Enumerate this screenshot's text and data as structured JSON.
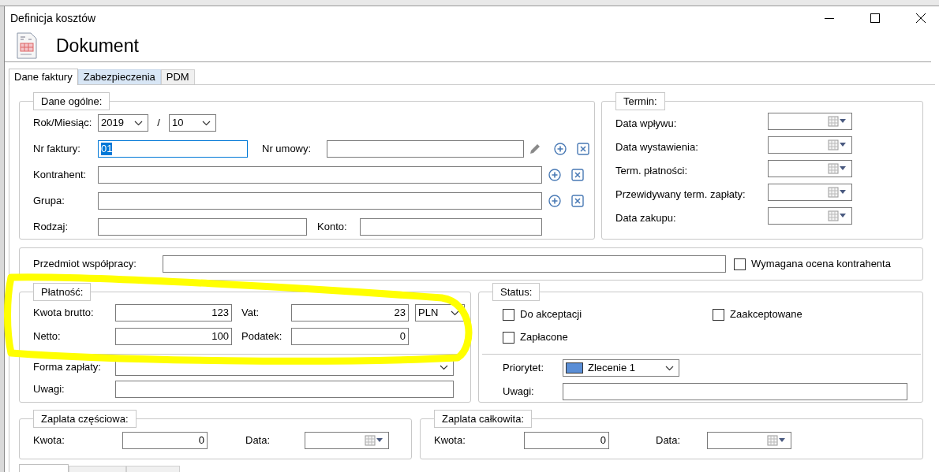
{
  "window": {
    "title": "Definicja kosztów"
  },
  "header": {
    "title": "Dokument"
  },
  "tabs": [
    {
      "label": "Dane faktury",
      "selected": true,
      "hovered": false
    },
    {
      "label": "Zabezpieczenia",
      "selected": false,
      "hovered": true
    },
    {
      "label": "PDM",
      "selected": false,
      "hovered": false
    }
  ],
  "general": {
    "legend": "Dane ogólne:",
    "period": {
      "label": "Rok/Miesiąc:",
      "year": "2019",
      "separator": "/",
      "month": "10"
    },
    "invoice_no": {
      "label": "Nr faktury:",
      "value": "01",
      "focused": true
    },
    "contract_no": {
      "label": "Nr umowy:"
    },
    "contractor": {
      "label": "Kontrahent:"
    },
    "group": {
      "label": "Grupa:"
    },
    "kind": {
      "label": "Rodzaj:"
    },
    "account": {
      "label": "Konto:"
    }
  },
  "terms": {
    "legend": "Termin:",
    "fields": [
      {
        "label": "Data wpływu:"
      },
      {
        "label": "Data wystawienia:"
      },
      {
        "label": "Term. płatności:"
      },
      {
        "label": "Przewidywany term. zapłaty:"
      },
      {
        "label": "Data zakupu:"
      }
    ]
  },
  "subject": {
    "label": "Przedmiot współpracy:",
    "checkbox": {
      "label": "Wymagana ocena kontrahenta",
      "checked": false
    }
  },
  "payment": {
    "legend": "Płatność:",
    "highlighted": true,
    "gross": {
      "label": "Kwota brutto:",
      "value": "123"
    },
    "vat": {
      "label": "Vat:",
      "value": "23"
    },
    "currency": "PLN",
    "net": {
      "label": "Netto:",
      "value": "100"
    },
    "tax": {
      "label": "Podatek:",
      "value": "0"
    },
    "method": {
      "label": "Forma zapłaty:"
    },
    "notes": {
      "label": "Uwagi:"
    }
  },
  "status": {
    "legend": "Status:",
    "checkboxes": [
      {
        "label": "Do akceptacji",
        "checked": false
      },
      {
        "label": "Zaakceptowane",
        "checked": false
      },
      {
        "label": "Zapłacone",
        "checked": false
      }
    ],
    "priority": {
      "label": "Priorytet:",
      "value": "Zlecenie 1",
      "color": "#5a8ed6"
    },
    "notes": {
      "label": "Uwagi:"
    }
  },
  "partial": {
    "legend": "Zaplata częściowa:",
    "amount": {
      "label": "Kwota:",
      "value": "0"
    },
    "date": {
      "label": "Data:"
    }
  },
  "total": {
    "legend": "Zaplata całkowita:",
    "amount": {
      "label": "Kwota:",
      "value": "0"
    },
    "date": {
      "label": "Data:"
    }
  },
  "bottom_tabs": [
    {
      "selected": true
    },
    {
      "selected": false
    },
    {
      "selected": false
    }
  ]
}
